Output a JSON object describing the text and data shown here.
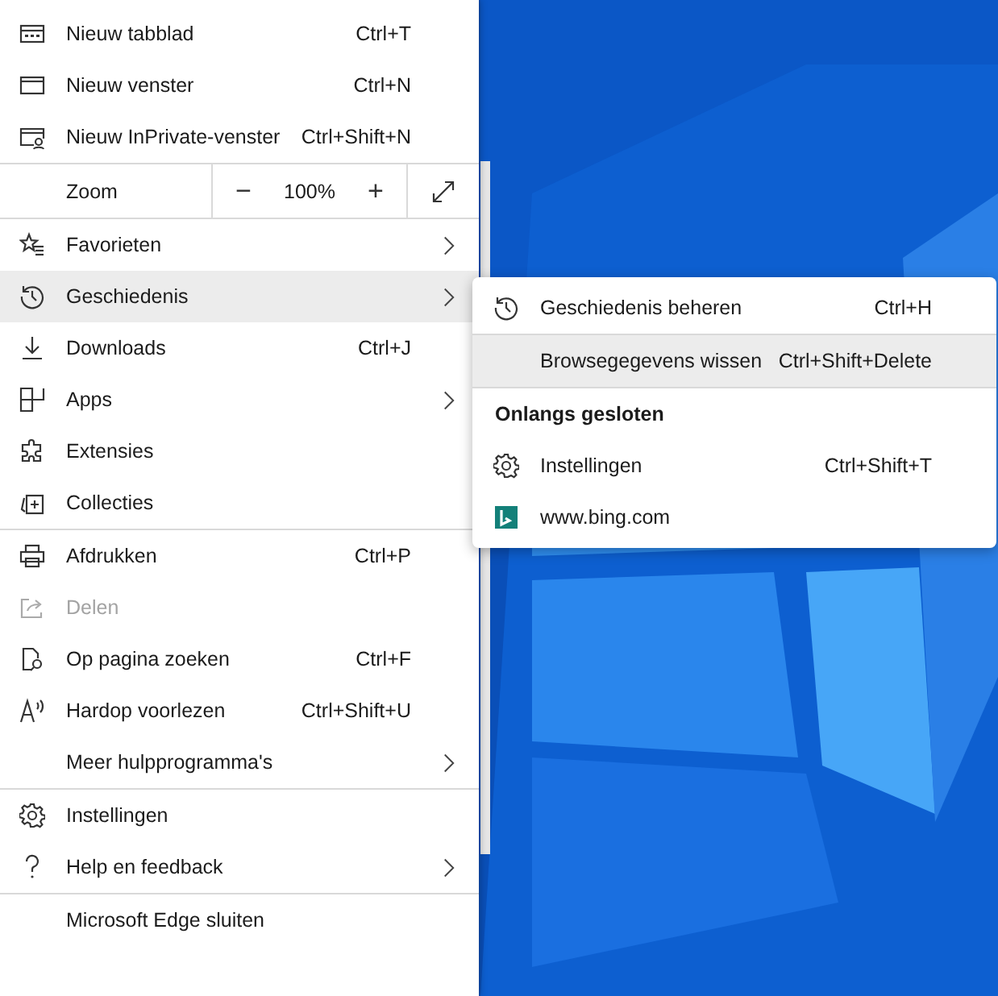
{
  "menu": {
    "groups": [
      {
        "items": [
          {
            "kind": "item",
            "label": "Nieuw tabblad",
            "shortcut": "Ctrl+T",
            "submenu": false,
            "selected": false,
            "disabled": false
          },
          {
            "kind": "item",
            "label": "Nieuw venster",
            "shortcut": "Ctrl+N",
            "submenu": false,
            "selected": false,
            "disabled": false
          },
          {
            "kind": "item",
            "label": "Nieuw InPrivate-venster",
            "shortcut": "Ctrl+Shift+N",
            "submenu": false,
            "selected": false,
            "disabled": false
          }
        ]
      },
      {
        "items": [
          {
            "kind": "zoom",
            "label": "Zoom",
            "minus": "−",
            "value": "100%",
            "plus": "+"
          }
        ]
      },
      {
        "items": [
          {
            "kind": "item",
            "label": "Favorieten",
            "submenu": true,
            "selected": false,
            "disabled": false
          },
          {
            "kind": "item",
            "label": "Geschiedenis",
            "submenu": true,
            "selected": true,
            "disabled": false
          },
          {
            "kind": "item",
            "label": "Downloads",
            "shortcut": "Ctrl+J",
            "submenu": false,
            "selected": false,
            "disabled": false
          },
          {
            "kind": "item",
            "label": "Apps",
            "submenu": true,
            "selected": false,
            "disabled": false
          },
          {
            "kind": "item",
            "label": "Extensies",
            "submenu": false,
            "selected": false,
            "disabled": false
          },
          {
            "kind": "item",
            "label": "Collecties",
            "submenu": false,
            "selected": false,
            "disabled": false
          }
        ]
      },
      {
        "items": [
          {
            "kind": "item",
            "label": "Afdrukken",
            "shortcut": "Ctrl+P",
            "submenu": false,
            "selected": false,
            "disabled": false
          },
          {
            "kind": "item",
            "label": "Delen",
            "submenu": false,
            "selected": false,
            "disabled": true
          },
          {
            "kind": "item",
            "label": "Op pagina zoeken",
            "shortcut": "Ctrl+F",
            "submenu": false,
            "selected": false,
            "disabled": false
          },
          {
            "kind": "item",
            "label": "Hardop voorlezen",
            "shortcut": "Ctrl+Shift+U",
            "submenu": false,
            "selected": false,
            "disabled": false
          },
          {
            "kind": "item",
            "label": "Meer hulpprogramma's",
            "submenu": true,
            "selected": false,
            "disabled": false
          }
        ]
      },
      {
        "items": [
          {
            "kind": "item",
            "label": "Instellingen",
            "submenu": false,
            "selected": false,
            "disabled": false
          },
          {
            "kind": "item",
            "label": "Help en feedback",
            "submenu": true,
            "selected": false,
            "disabled": false
          }
        ]
      },
      {
        "items": [
          {
            "kind": "item",
            "label": "Microsoft Edge sluiten",
            "submenu": false,
            "selected": false,
            "disabled": false
          }
        ]
      }
    ]
  },
  "submenu": {
    "groups": [
      {
        "items": [
          {
            "kind": "item",
            "label": "Geschiedenis beheren",
            "shortcut": "Ctrl+H",
            "selected": false
          }
        ]
      },
      {
        "items": [
          {
            "kind": "item",
            "label": "Browsegegevens wissen",
            "shortcut": "Ctrl+Shift+Delete",
            "selected": true
          }
        ]
      },
      {
        "items": [
          {
            "kind": "heading",
            "label": "Onlangs gesloten"
          },
          {
            "kind": "item",
            "label": "Instellingen",
            "shortcut": "Ctrl+Shift+T",
            "selected": false
          },
          {
            "kind": "item",
            "label": "www.bing.com",
            "selected": false
          }
        ]
      }
    ]
  }
}
